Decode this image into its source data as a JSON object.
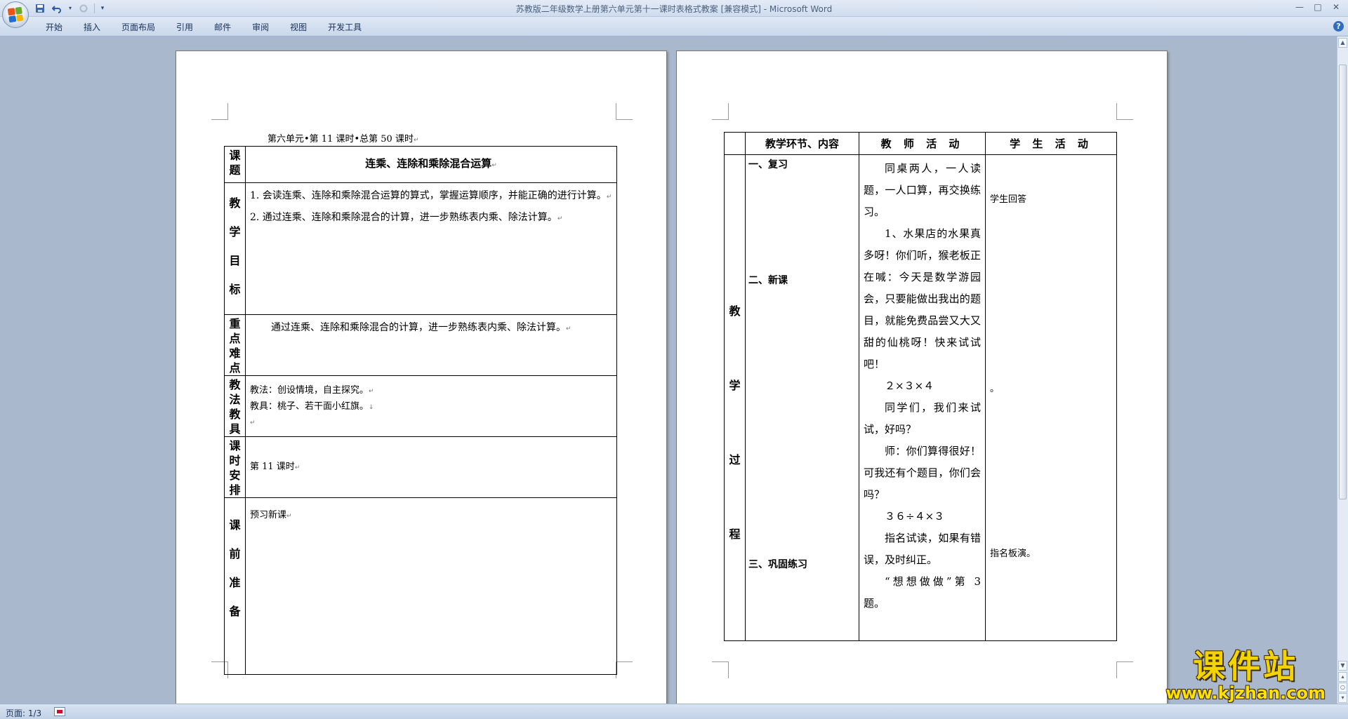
{
  "app": {
    "window_title": "苏教版二年级数学上册第六单元第十一课时表格式教案 [兼容模式] - Microsoft Word",
    "colors": {
      "ribbon": "#cad8eb",
      "doc_bg": "#a9b8cc",
      "watermark": "#f3d400"
    }
  },
  "ribbon": {
    "tabs": [
      "开始",
      "插入",
      "页面布局",
      "引用",
      "邮件",
      "审阅",
      "视图",
      "开发工具"
    ]
  },
  "icons": {
    "office": "office-logo",
    "save": "save-icon",
    "undo": "undo-icon",
    "redo": "redo-icon",
    "customize": "dropdown-icon",
    "help": "?"
  },
  "window_controls": {
    "minimize": "—",
    "maximize": "□",
    "close": "✕"
  },
  "paragraph_mark": "↵",
  "page1": {
    "header": "第六单元•第 11 课时•总第 50 课时",
    "rows": {
      "topic_label": [
        "课",
        "题"
      ],
      "topic": "连乘、连除和乘除混合运算",
      "goals_label": [
        "教",
        "学",
        "目",
        "标"
      ],
      "goals": [
        "1. 会读连乘、连除和乘除混合运算的算式，掌握运算顺序，并能正确的进行计算。",
        "2. 通过连乘、连除和乘除混合的计算，进一步熟练表内乘、除法计算。"
      ],
      "key_label": [
        "重",
        "点",
        "难",
        "点"
      ],
      "key": "通过连乘、连除和乘除混合的计算，进一步熟练表内乘、除法计算。",
      "method_label": [
        "教",
        "法",
        "教",
        "具"
      ],
      "method": "教法：创设情境，自主探究。",
      "tools": "教具：桃子、若干面小红旗。",
      "schedule_label": [
        "课",
        "时",
        "安",
        "排"
      ],
      "schedule": "第 11 课时",
      "prep_label": [
        "课",
        "前",
        "准",
        "备"
      ],
      "prep": "预习新课"
    }
  },
  "page2": {
    "headers": [
      "教学环节、内容",
      "教 师 活 动",
      "学 生 活 动"
    ],
    "side_label": [
      "教",
      "学",
      "过",
      "程"
    ],
    "sections": [
      "一、复习",
      "二、新课",
      "三、巩固练习"
    ],
    "teacher": [
      "同桌两人，一人读题，一人口算，再交换练习。",
      "1、水果店的水果真多呀！你们听，猴老板正在喊：今天是数学游园会，只要能做出我出的题目，就能免费品尝又大又甜的仙桃呀！快来试试吧！",
      "２×３×４",
      "同学们，我们来试试，好吗？",
      "师：你们算得很好！可我还有个题目，你们会吗？",
      "３６÷４×３",
      "指名试读，如果有错误，及时纠正。",
      "“想想做做”第 3 题。"
    ],
    "student": [
      "学生回答",
      "。",
      "指名板演。"
    ]
  },
  "statusbar": {
    "page": "页面: 1/3"
  },
  "watermark": {
    "brand": "课件站",
    "url": "www.kjzhan.com"
  }
}
